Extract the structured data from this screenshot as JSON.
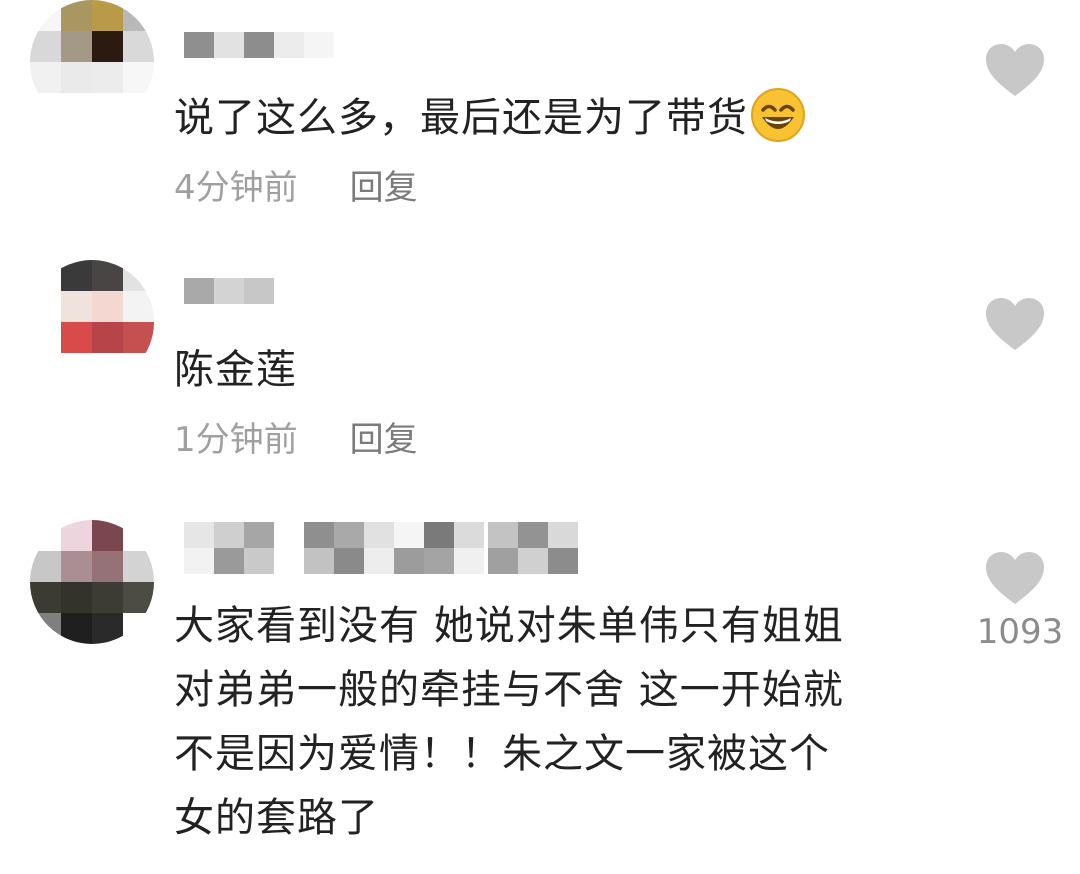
{
  "comments": [
    {
      "text": "说了这么多，最后还是为了带货",
      "emoji": "grinning-smiling-eyes-emoji",
      "time": "4分钟前",
      "reply_label": "回复",
      "like_count": ""
    },
    {
      "text": "陈金莲",
      "time": "1分钟前",
      "reply_label": "回复",
      "like_count": ""
    },
    {
      "text_lines": [
        "大家看到没有 她说对朱单伟只有姐姐",
        "对弟弟一般的牵挂与不舍 这一开始就",
        "不是因为爱情！！朱之文一家被这个",
        "女的套路了"
      ],
      "like_count": "1093"
    }
  ],
  "icons": {
    "like": "heart-icon",
    "avatar": "pixelated-avatar",
    "username": "pixelated-username"
  },
  "colors": {
    "text": "#222222",
    "meta": "#a0a0a0",
    "heart": "#c8c8c8"
  }
}
